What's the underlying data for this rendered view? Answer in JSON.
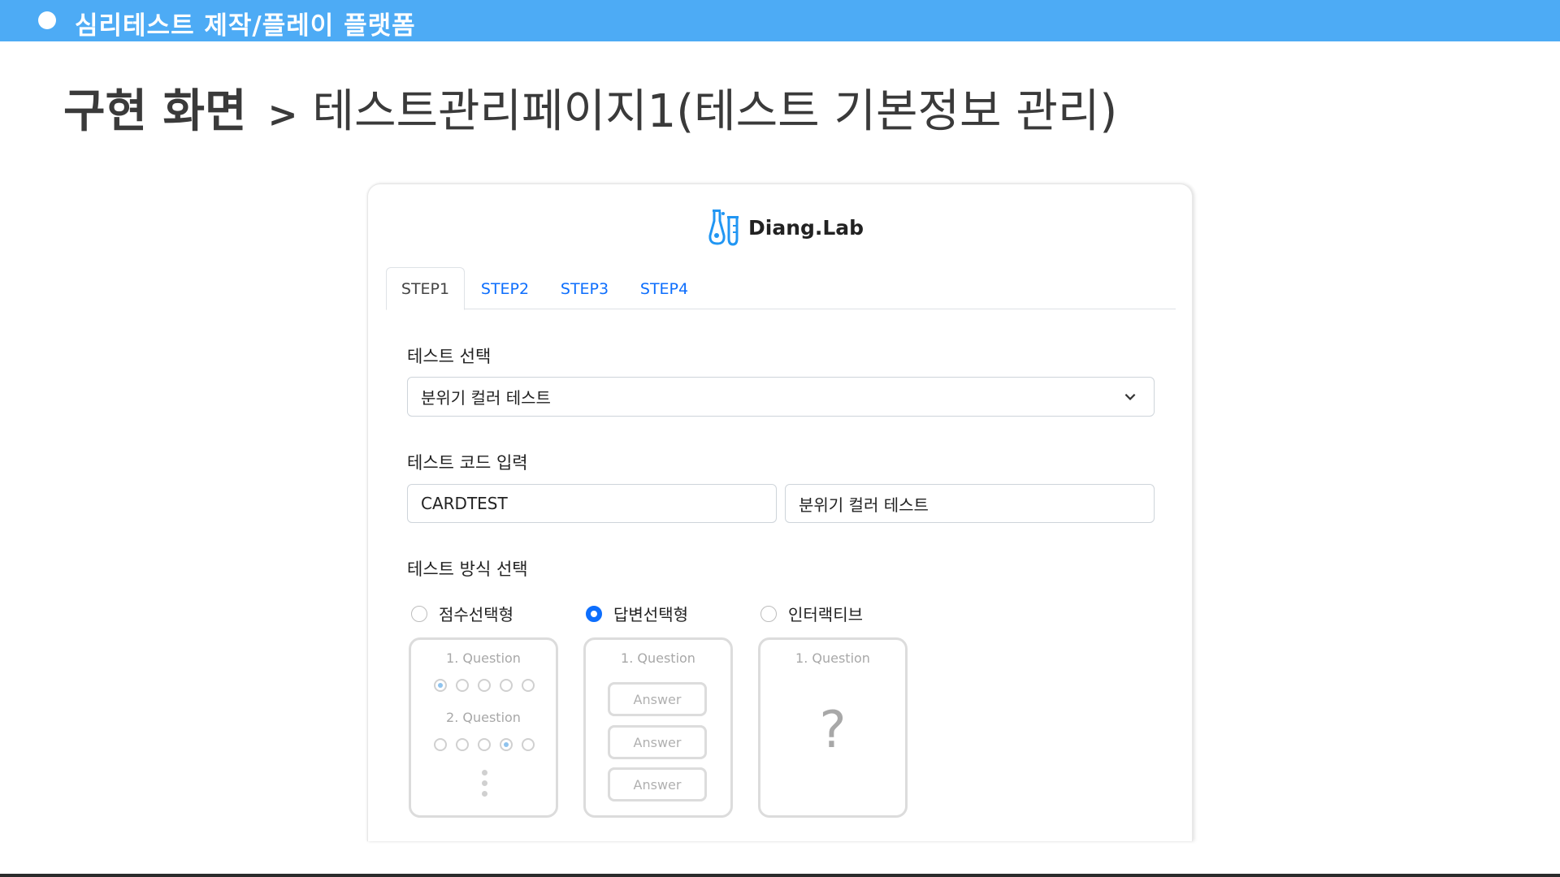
{
  "header": {
    "title": "심리테스트 제작/플레이 플랫폼"
  },
  "heading": {
    "bold": "구현 화면",
    "arrow": ">",
    "sub": "테스트관리페이지1(테스트 기본정보 관리)"
  },
  "app": {
    "logo_text": "Diang.Lab",
    "tabs": [
      {
        "label": "STEP1",
        "active": true
      },
      {
        "label": "STEP2",
        "active": false
      },
      {
        "label": "STEP3",
        "active": false
      },
      {
        "label": "STEP4",
        "active": false
      }
    ],
    "test_select": {
      "label": "테스트 선택",
      "value": "분위기 컬러 테스트"
    },
    "test_code": {
      "label": "테스트 코드 입력",
      "code_value": "CARDTEST",
      "name_value": "분위기 컬러 테스트"
    },
    "test_type": {
      "label": "테스트 방식 선택",
      "options": [
        {
          "label": "점수선택형",
          "checked": false
        },
        {
          "label": "답변선택형",
          "checked": true
        },
        {
          "label": "인터랙티브",
          "checked": false
        }
      ]
    },
    "previews": {
      "score": {
        "q1": "1. Question",
        "q2": "2. Question"
      },
      "answer": {
        "q1": "1. Question",
        "answers": [
          "Answer",
          "Answer",
          "Answer"
        ]
      },
      "interactive": {
        "q1": "1. Question",
        "mark": "?"
      }
    }
  },
  "colors": {
    "header_bg": "#4dabf5",
    "accent": "#0d6efd"
  }
}
